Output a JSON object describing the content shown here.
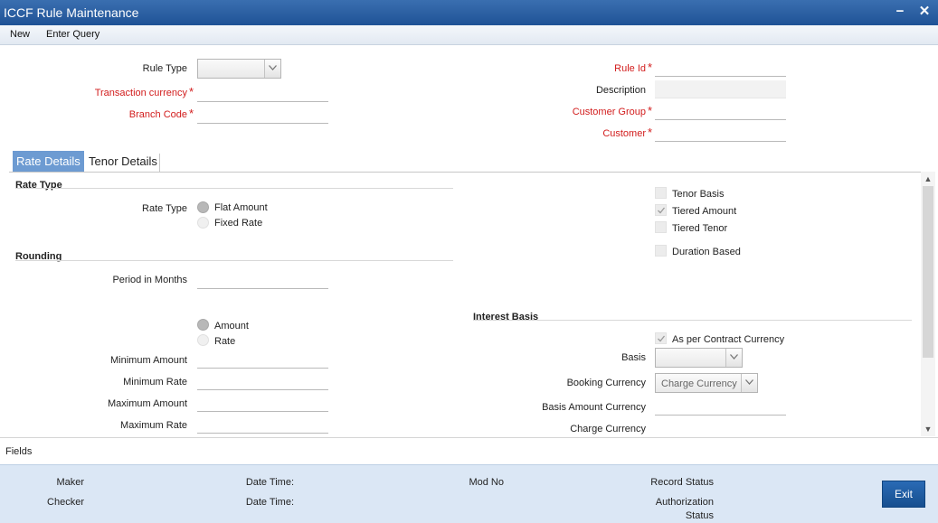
{
  "window": {
    "title": "ICCF Rule Maintenance",
    "minimize": "−",
    "close": "✕"
  },
  "menu": {
    "new": "New",
    "enter_query": "Enter Query"
  },
  "header": {
    "rule_type_label": "Rule Type",
    "rule_type_value": "",
    "transaction_currency_label": "Transaction currency",
    "branch_code_label": "Branch Code",
    "rule_id_label": "Rule Id",
    "description_label": "Description",
    "customer_group_label": "Customer Group",
    "customer_label": "Customer",
    "required_mark": "*"
  },
  "tabs": [
    {
      "label": "Rate Details",
      "active": true
    },
    {
      "label": "Tenor Details",
      "active": false
    }
  ],
  "rate_type": {
    "section": "Rate Type",
    "label": "Rate Type",
    "options": [
      "Flat Amount",
      "Fixed Rate"
    ],
    "selected": "Flat Amount"
  },
  "checkboxes": [
    {
      "label": "Tenor Basis",
      "checked": false
    },
    {
      "label": "Tiered Amount",
      "checked": true
    },
    {
      "label": "Tiered Tenor",
      "checked": false
    },
    {
      "label": "Duration Based",
      "checked": false
    }
  ],
  "rounding": {
    "section": "Rounding",
    "period_label": "Period in Months",
    "options": [
      "Amount",
      "Rate"
    ],
    "selected": "Amount",
    "min_amount_label": "Minimum Amount",
    "min_rate_label": "Minimum Rate",
    "max_amount_label": "Maximum Amount",
    "max_rate_label": "Maximum Rate"
  },
  "interest_basis": {
    "section": "Interest Basis",
    "as_per_contract_label": "As per Contract Currency",
    "as_per_contract_checked": true,
    "basis_label": "Basis",
    "basis_value": "",
    "booking_currency_label": "Booking Currency",
    "booking_currency_value": "Charge Currency",
    "basis_amount_currency_label": "Basis Amount Currency",
    "charge_currency_label": "Charge Currency"
  },
  "fields_bar": {
    "label": "Fields"
  },
  "footer": {
    "maker": "Maker",
    "checker": "Checker",
    "date_time_1": "Date Time:",
    "date_time_2": "Date Time:",
    "mod_no": "Mod No",
    "record_status": "Record Status",
    "authorization": "Authorization",
    "status": "Status",
    "exit": "Exit"
  }
}
